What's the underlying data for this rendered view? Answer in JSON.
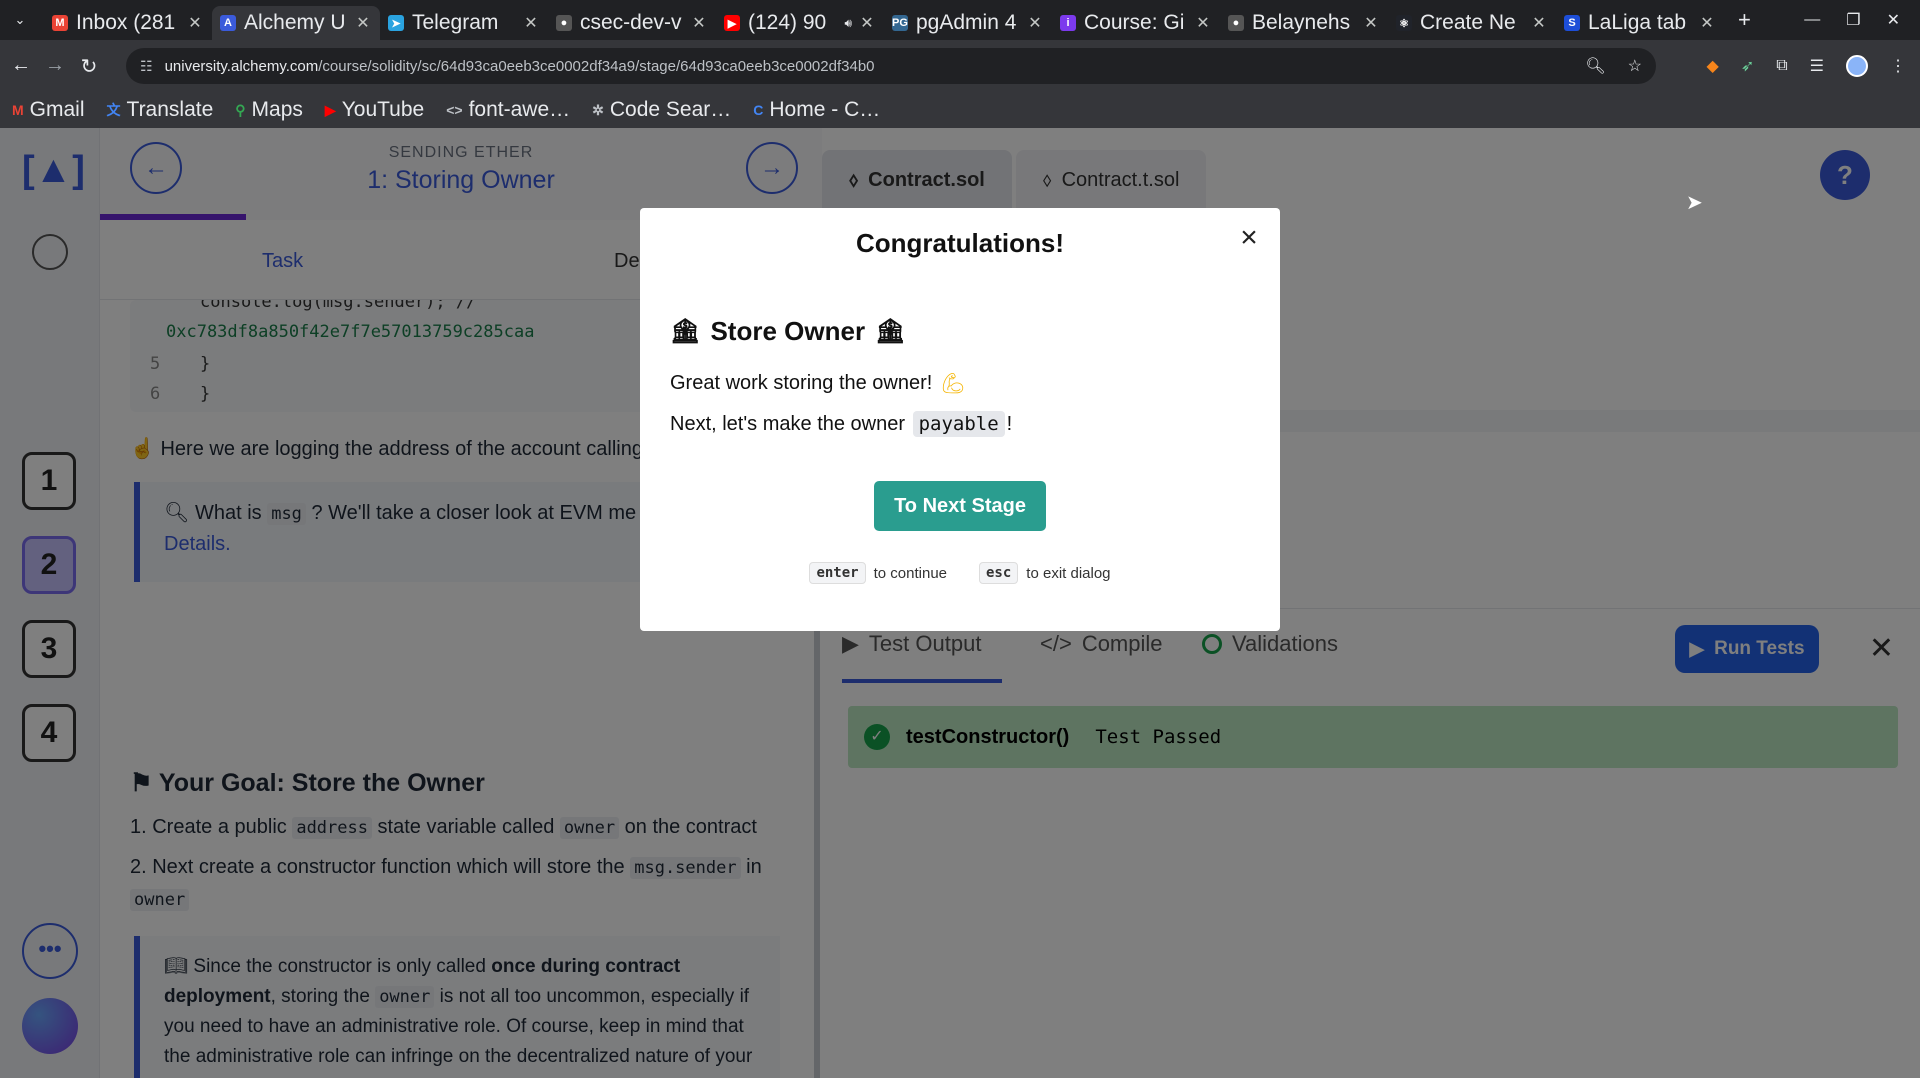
{
  "browser": {
    "tabs": [
      {
        "title": "Inbox (281",
        "icon": "gmail-icon",
        "fav": "M",
        "color": "#ea4335",
        "active": false
      },
      {
        "title": "Alchemy U",
        "icon": "alchemy-icon",
        "fav": "A",
        "color": "#3b5bdb",
        "active": true
      },
      {
        "title": "Telegram",
        "icon": "telegram-icon",
        "fav": "➤",
        "color": "#2aa3e0",
        "active": false
      },
      {
        "title": "csec-dev-v",
        "icon": "github-icon",
        "fav": "●",
        "color": "#555",
        "active": false
      },
      {
        "title": "(124) 90",
        "icon": "youtube-icon",
        "fav": "▶",
        "color": "#ff0000",
        "active": false,
        "audio": true
      },
      {
        "title": "pgAdmin 4",
        "icon": "pgadmin-icon",
        "fav": "PG",
        "color": "#336791",
        "active": false
      },
      {
        "title": "Course: Gi",
        "icon": "course-icon",
        "fav": "i",
        "color": "#7c3aed",
        "active": false
      },
      {
        "title": "Belaynehs",
        "icon": "github-icon",
        "fav": "●",
        "color": "#555",
        "active": false
      },
      {
        "title": "Create Ne",
        "icon": "react-icon",
        "fav": "⚛",
        "color": "#20232a",
        "active": false
      },
      {
        "title": "LaLiga tab",
        "icon": "laliga-icon",
        "fav": "S",
        "color": "#1d4ed8",
        "active": false
      }
    ],
    "new_tab": "+",
    "url_host": "university.alchemy.com",
    "url_path": "/course/solidity/sc/64d93ca0eeb3ce0002df34a9/stage/64d93ca0eeb3ce0002df34b0",
    "bookmarks": [
      {
        "label": "Gmail",
        "icon": "gmail-icon",
        "glyph": "M",
        "color": "#ea4335"
      },
      {
        "label": "Translate",
        "icon": "translate-icon",
        "glyph": "文",
        "color": "#4285f4"
      },
      {
        "label": "Maps",
        "icon": "maps-icon",
        "glyph": "⚲",
        "color": "#34a853"
      },
      {
        "label": "YouTube",
        "icon": "youtube-icon",
        "glyph": "▶",
        "color": "#ff0000"
      },
      {
        "label": "font-awe…",
        "icon": "code-icon",
        "glyph": "<>",
        "color": "#bdc1c6"
      },
      {
        "label": "Code Sear…",
        "icon": "code-search-icon",
        "glyph": "✲",
        "color": "#bdc1c6"
      },
      {
        "label": "Home - C…",
        "icon": "home-c-icon",
        "glyph": "C",
        "color": "#4285f4"
      }
    ]
  },
  "app": {
    "section": "SENDING ETHER",
    "lesson_title": "1: Storing Owner",
    "stages": [
      "1",
      "2",
      "3",
      "4"
    ],
    "current_stage": "2",
    "left_tabs": [
      "Task",
      "De"
    ],
    "code": {
      "lines": [
        {
          "n": "",
          "t": "console.log(msg.sender); //"
        },
        {
          "n": "",
          "t": "0xc783df8a850f42e7f7e57013759c285caa"
        },
        {
          "n": "5",
          "t": "    }"
        },
        {
          "n": "6",
          "t": "}"
        }
      ]
    },
    "note_logging": "Here we are logging the address of the account calling",
    "callout1_pre": "What is",
    "callout1_code": "msg",
    "callout1_post": "? We'll take a closer look at EVM me",
    "callout1_link": "Details.",
    "goal_title": "Your Goal: Store the Owner",
    "goal_steps": {
      "s1_a": "1. Create a public",
      "s1_c1": "address",
      "s1_b": "state variable called",
      "s1_c2": "owner",
      "s1_d": "on the contract",
      "s2_a": "2. Next create a constructor function which will store the",
      "s2_c1": "msg.sender",
      "s2_b": "in",
      "s2_c2": "owner"
    },
    "callout2": {
      "a": "Since the constructor is only called",
      "b": "once during contract deployment",
      "c": ", storing the",
      "code": "owner",
      "d": "is not all too uncommon, especially if you need to have an administrative role. Of course, keep in mind that the administrative role can infringe on the decentralized nature of your contract!"
    },
    "editor_tabs": [
      "Contract.sol",
      "Contract.t.sol"
    ],
    "help": "?",
    "bottom_tabs": [
      "Test Output",
      "Compile",
      "Validations"
    ],
    "run_tests": "Run Tests",
    "test_name": "testConstructor()",
    "test_status": "Test Passed"
  },
  "modal": {
    "title": "Congratulations!",
    "heading": "Store Owner",
    "line1": "Great work storing the owner!",
    "line2_pre": "Next, let's make the owner ",
    "line2_code": "payable",
    "line2_post": "!",
    "button": "To Next Stage",
    "hint_enter_key": "enter",
    "hint_enter": "to continue",
    "hint_esc_key": "esc",
    "hint_esc": "to exit dialog"
  },
  "colors": {
    "accent": "#3b5bdb",
    "modal_button": "#2a9d8f",
    "test_pass_bg": "#bde8c3"
  }
}
